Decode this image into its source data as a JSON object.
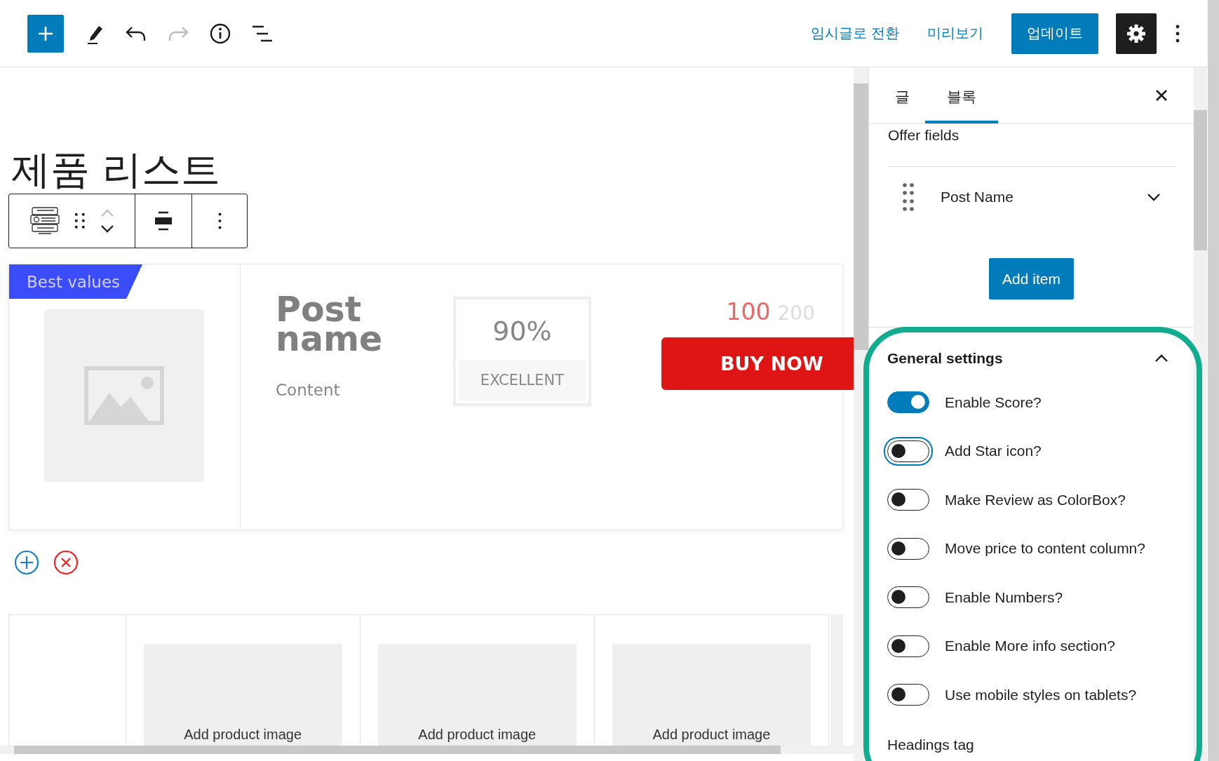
{
  "tools": [
    {
      "kind": "add",
      "disabled": false
    },
    {
      "kind": "edit",
      "disabled": false
    },
    {
      "kind": "undo",
      "disabled": false
    },
    {
      "kind": "redo",
      "disabled": true
    },
    {
      "kind": "info",
      "disabled": false
    },
    {
      "kind": "outline",
      "disabled": false
    }
  ],
  "actions": {
    "switch_to_draft": "임시글로 전환",
    "preview": "미리보기",
    "update": "업데이트",
    "settings_pressed": true
  },
  "editor": {
    "title": "제품 리스트",
    "block_toolbar": {
      "move_up_disabled": true
    },
    "card": {
      "badge": "Best values",
      "post_name": "Post name",
      "content": "Content",
      "score": "90%",
      "score_label": "EXCELLENT",
      "price": "100",
      "old_price": "200",
      "button": "BUY NOW"
    },
    "table": {
      "columns": [
        {
          "image_label": "Add product image"
        },
        {
          "image_label": "Add product image"
        },
        {
          "image_label": "Add product image"
        }
      ]
    }
  },
  "sidebar": {
    "tabs": [
      {
        "label": "글",
        "selected": false
      },
      {
        "label": "블록",
        "selected": true
      }
    ],
    "offer_fields": "Offer fields",
    "fields": [
      {
        "label": "Post Name",
        "expanded": false
      }
    ],
    "add_item": "Add item",
    "general_settings": {
      "title": "General settings",
      "expanded": true,
      "toggles": [
        {
          "label": "Enable Score?",
          "on": true,
          "focused": false
        },
        {
          "label": "Add Star icon?",
          "on": false,
          "focused": true
        },
        {
          "label": "Make Review as ColorBox?",
          "on": false,
          "focused": false
        },
        {
          "label": "Move price to content column?",
          "on": false,
          "focused": false
        },
        {
          "label": "Enable Numbers?",
          "on": false,
          "focused": false
        },
        {
          "label": "Enable More info section?",
          "on": false,
          "focused": false
        },
        {
          "label": "Use mobile styles on tablets?",
          "on": false,
          "focused": false
        }
      ],
      "headings_tag": "Headings tag"
    }
  }
}
